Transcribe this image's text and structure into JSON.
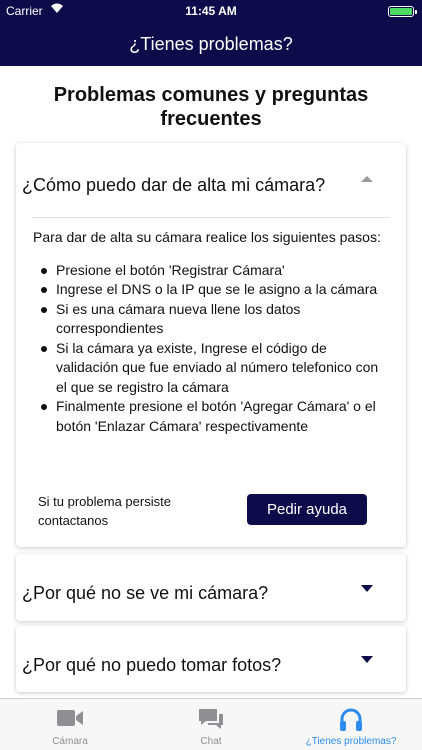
{
  "status_bar": {
    "carrier": "Carrier",
    "time": "11:45 AM"
  },
  "nav": {
    "title": "¿Tienes problemas?"
  },
  "page_title": "Problemas comunes y preguntas frecuentes",
  "faq": [
    {
      "question": "¿Cómo puedo dar de alta mi cámara?",
      "expanded": true,
      "intro": "Para dar de alta su cámara realice los siguientes pasos:",
      "steps": [
        "Presione el botón 'Registrar Cámara'",
        "Ingrese el DNS o la IP que se le asigno a la cámara",
        "Si es una cámara nueva llene los datos correspondientes",
        "Si la cámara ya existe, Ingrese el código de validación que fue enviado al número telefonico con el que se registro la cámara",
        "Finalmente presione el botón 'Agregar Cámara' o el botón 'Enlazar Cámara' respectivamente"
      ],
      "help_text": "Si tu problema persiste contactanos",
      "help_button": "Pedir ayuda"
    },
    {
      "question": "¿Por qué no se ve mi cámara?",
      "expanded": false
    },
    {
      "question": "¿Por qué no puedo tomar fotos?",
      "expanded": false
    }
  ],
  "tabs": [
    {
      "label": "Cámara",
      "icon": "video-camera-icon",
      "active": false
    },
    {
      "label": "Chat",
      "icon": "chat-bubbles-icon",
      "active": false
    },
    {
      "label": "¿Tienes problemas?",
      "icon": "headphones-icon",
      "active": true
    }
  ],
  "colors": {
    "brand": "#0d0b4a",
    "tab_active": "#2d8cf0",
    "tab_inactive": "#8e8e93",
    "battery": "#4cd964"
  }
}
